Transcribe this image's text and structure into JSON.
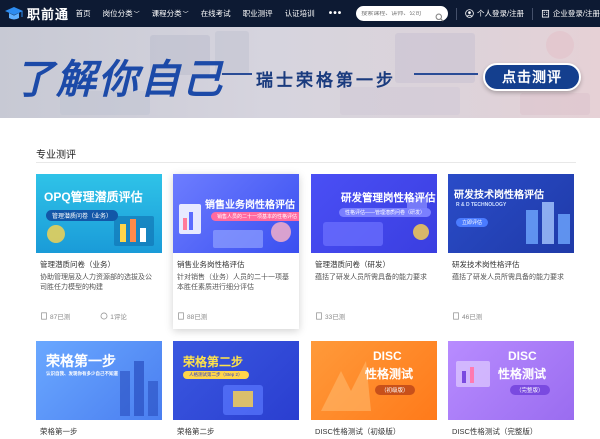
{
  "brand": {
    "name": "职前通"
  },
  "nav": {
    "items": [
      {
        "label": "首页",
        "chevron": false
      },
      {
        "label": "岗位分类",
        "chevron": true
      },
      {
        "label": "课程分类",
        "chevron": true
      },
      {
        "label": "在线考试",
        "chevron": false
      },
      {
        "label": "职业测评",
        "chevron": false
      },
      {
        "label": "认证培训",
        "chevron": false
      }
    ],
    "more": "•••",
    "search_placeholder": "搜索课程、讲师、公司",
    "login_personal": "个人登录/注册",
    "login_company": "企业登录/注册"
  },
  "banner": {
    "title": "了解你自己",
    "subtitle": "瑞士荣格第一步",
    "button": "点击测评"
  },
  "section": {
    "title": "专业测评"
  },
  "cards": [
    {
      "thumb_title": "OPQ管理潜质评估",
      "thumb_pill": "管理潜质问卷（业务）",
      "title": "管理潜质问卷（业务）",
      "desc": "协助管理层及人力资源部的选拔及公司胜任力模型的构建",
      "count": "87已测",
      "comments": "1评论"
    },
    {
      "thumb_title": "销售业务岗性格评估",
      "thumb_pill": "销售人员的二十一项基本的性格评估",
      "title": "销售业务岗性格评估",
      "desc": "针对销售（业务）人员的二十一项基本胜任素质进行细分评估",
      "count": "88已测",
      "comments": ""
    },
    {
      "thumb_title": "研发管理岗性格评估",
      "thumb_pill": "性格评估——管理潜质问卷（研发）",
      "title": "管理潜质问卷（研发）",
      "desc": "蕴括了研发人员所需具备的能力要求",
      "count": "33已测",
      "comments": ""
    },
    {
      "thumb_title": "研发技术岗性格评估",
      "thumb_pill": "立即评估",
      "thumb_sub": "R & D TECHNOLOGY",
      "title": "研发技术岗性格评估",
      "desc": "蕴括了研发人员所需具备的能力要求",
      "count": "46已测",
      "comments": ""
    },
    {
      "thumb_title": "荣格第一步",
      "thumb_sub": "认识自我、发现你有多少自己不知道",
      "title": "荣格第一步",
      "desc": "",
      "count": "",
      "comments": ""
    },
    {
      "thumb_title": "荣格第二步",
      "thumb_pill": "人格测试第二步（Step 2）",
      "title": "荣格第二步",
      "desc": "",
      "count": "",
      "comments": ""
    },
    {
      "thumb_title": "DISC",
      "thumb_title2": "性格测试",
      "thumb_pill": "（初级版）",
      "title": "DISC性格测试（初级版）",
      "desc": "",
      "count": "",
      "comments": ""
    },
    {
      "thumb_title": "DISC",
      "thumb_title2": "性格测试",
      "thumb_pill": "（完整版）",
      "title": "DISC性格测试（完整版）",
      "desc": "",
      "count": "",
      "comments": ""
    }
  ],
  "colors": {
    "nav_bg": "#0d1a33",
    "brand_blue": "#1c4aa8",
    "button_blue": "#143f8e"
  }
}
